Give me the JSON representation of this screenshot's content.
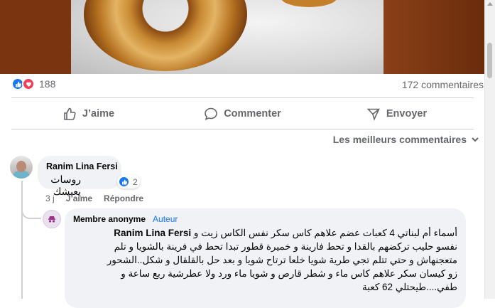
{
  "post": {
    "reaction_count": "188",
    "comments_count": "172 commentaires"
  },
  "actions": {
    "like": "J’aime",
    "comment": "Commenter",
    "share": "Envoyer"
  },
  "sort": {
    "label": "Les meilleurs commentaires"
  },
  "comments": [
    {
      "author": "Ranim Lina Fersi",
      "text": "روسات يعيشك",
      "reactions": "2",
      "time": "3 j",
      "like_label": "J’aime",
      "reply_label": "Répondre"
    }
  ],
  "reply": {
    "author": "Membre anonyme",
    "badge": "Auteur",
    "mention": "Ranim Lina Fersi",
    "text_line1": "أسماء أم لبناتي 4 كعبات عضم علاهم كاس سكر نفس الكاس زيت و",
    "text_line2": "نفسو حليب تركضهم بالقدا و تحط فارينة و خميرة قطور تبدا تحط في فرينة بالشويا و تلم",
    "text_line3": "متعجنهاش و حتي تتلم تجي طرية شويا خلعا ترتاح شويا و بعد حل بالقلقال و شكل..الشحور",
    "text_line4": "زو كيسان سكر علاهم كاس ماء و شطر قارص و شويا ماء ورد ولا عطرشية ربع ساعة و",
    "text_line5": "طفي....طيحتلي 62 كعبة"
  }
}
